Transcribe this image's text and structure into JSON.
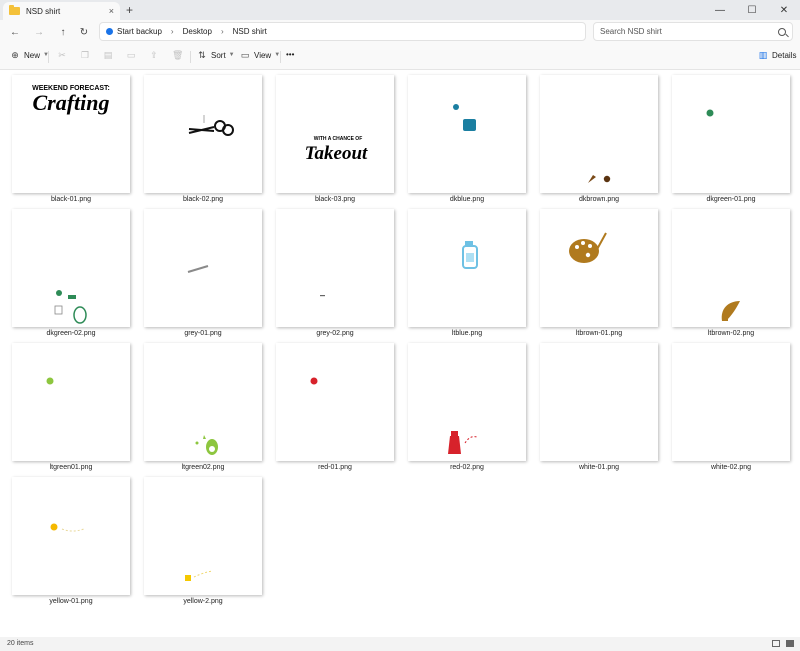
{
  "window": {
    "tab_title": "NSD shirt",
    "tab_close": "×",
    "new_tab": "+",
    "minimize": "—",
    "maximize": "☐",
    "close": "✕"
  },
  "address": {
    "crumbs": [
      "Start backup",
      "Desktop",
      "NSD shirt"
    ],
    "search_placeholder": "Search NSD shirt"
  },
  "toolbar": {
    "new_label": "New",
    "sort_label": "Sort",
    "view_label": "View",
    "more_label": "•••",
    "details_label": "Details"
  },
  "files": [
    {
      "name": "black-01.png",
      "art": "text-crafting",
      "art_text": [
        "WEEKEND FORECAST:",
        "Crafting"
      ]
    },
    {
      "name": "black-02.png",
      "art": "scissors"
    },
    {
      "name": "black-03.png",
      "art": "text-takeout",
      "art_text": [
        "WITH A CHANCE OF",
        "Takeout"
      ]
    },
    {
      "name": "dkblue.png",
      "art": "dkblue"
    },
    {
      "name": "dkbrown.png",
      "art": "dkbrown"
    },
    {
      "name": "dkgreen-01.png",
      "art": "dot",
      "color": "#2e8b57"
    },
    {
      "name": "dkgreen-02.png",
      "art": "dkgreen2"
    },
    {
      "name": "grey-01.png",
      "art": "grey1"
    },
    {
      "name": "grey-02.png",
      "art": "grey2"
    },
    {
      "name": "ltblue.png",
      "art": "bottle"
    },
    {
      "name": "ltbrown-01.png",
      "art": "palette"
    },
    {
      "name": "ltbrown-02.png",
      "art": "leaf"
    },
    {
      "name": "ltgreen01.png",
      "art": "dot",
      "color": "#8dc63f"
    },
    {
      "name": "ltgreen02.png",
      "art": "avocado"
    },
    {
      "name": "red-01.png",
      "art": "dot",
      "color": "#d7222b"
    },
    {
      "name": "red-02.png",
      "art": "ketchup"
    },
    {
      "name": "white-01.png",
      "art": "blank"
    },
    {
      "name": "white-02.png",
      "art": "blank"
    },
    {
      "name": "yellow-01.png",
      "art": "yellow1"
    },
    {
      "name": "yellow-2.png",
      "art": "yellow2"
    }
  ],
  "status": {
    "item_count": "20 items"
  },
  "colors": {
    "accent": "#1a73e8",
    "folder": "#f4c13a"
  }
}
